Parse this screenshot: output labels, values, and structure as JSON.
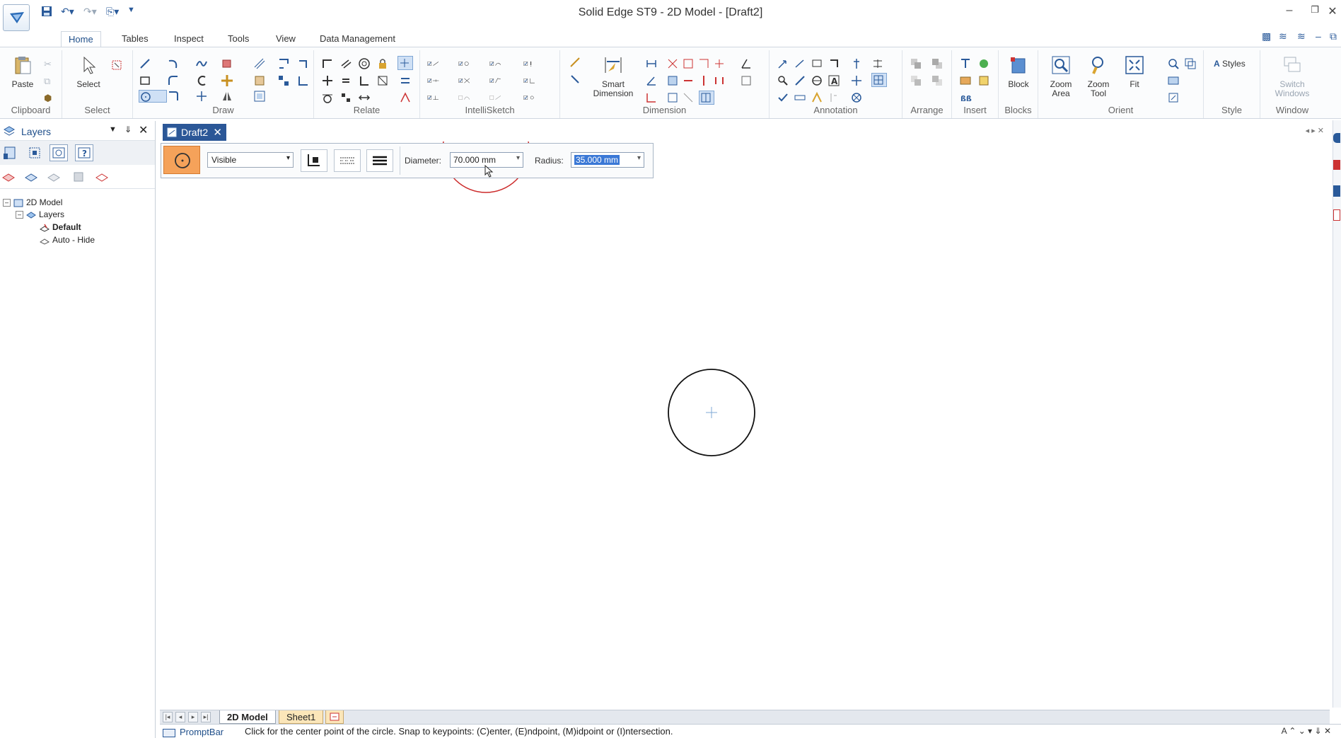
{
  "window": {
    "title": "Solid Edge ST9 - 2D Model - [Draft2]",
    "minimize_glyph": "–",
    "restore_glyph": "❐",
    "close_glyph": "✕"
  },
  "ribbon": {
    "tabs": [
      "Home",
      "Tables",
      "Inspect",
      "Tools",
      "View",
      "Data Management"
    ],
    "active_tab": "Home",
    "groups": {
      "clipboard": {
        "label": "Clipboard",
        "paste": "Paste"
      },
      "select": {
        "label": "Select",
        "select": "Select"
      },
      "draw": {
        "label": "Draw"
      },
      "relate": {
        "label": "Relate"
      },
      "intellisketch": {
        "label": "IntelliSketch"
      },
      "dimension": {
        "label": "Dimension",
        "smart_dimension_line1": "Smart",
        "smart_dimension_line2": "Dimension"
      },
      "annotation": {
        "label": "Annotation"
      },
      "arrange": {
        "label": "Arrange"
      },
      "insert": {
        "label": "Insert"
      },
      "blocks": {
        "label": "Blocks",
        "block": "Block"
      },
      "orient": {
        "label": "Orient",
        "zoom_area_line1": "Zoom",
        "zoom_area_line2": "Area",
        "zoom_tool_line1": "Zoom",
        "zoom_tool_line2": "Tool",
        "fit": "Fit"
      },
      "style": {
        "label": "Style",
        "styles": "Styles"
      },
      "window": {
        "label": "Window",
        "switch_windows_line1": "Switch",
        "switch_windows_line2": "Windows"
      }
    }
  },
  "layers_pane": {
    "title": "Layers",
    "tree": {
      "root": "2D Model",
      "layers": "Layers",
      "default": "Default",
      "auto_hide": "Auto - Hide"
    }
  },
  "document": {
    "tab_label": "Draft2"
  },
  "command_bar": {
    "line_style": "Visible",
    "diameter_label": "Diameter:",
    "diameter_value": "70.000 mm",
    "radius_label": "Radius:",
    "radius_value": "35.000 mm"
  },
  "sheet_tabs": [
    "2D Model",
    "Sheet1"
  ],
  "prompt_bar": {
    "title": "PromptBar",
    "text": "Click for the center point of the circle. Snap to keypoints: (C)enter, (E)ndpoint, (M)idpoint or (I)ntersection."
  },
  "colors": {
    "accent": "#2b5797",
    "active_command": "#f5a25a",
    "preview_circle": "#cc2a2a",
    "drawn_circle": "#111111",
    "center_mark": "#7fa9d6"
  }
}
